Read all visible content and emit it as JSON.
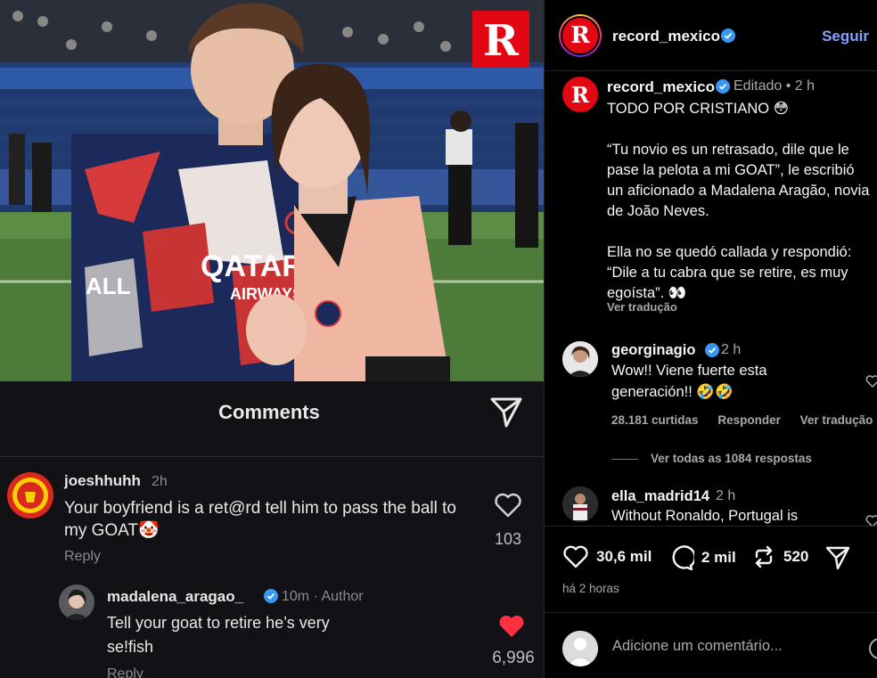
{
  "media": {
    "brand_logo_letter": "R",
    "embedded": {
      "title": "Comments",
      "comment1": {
        "user": "joeshhuhh",
        "time": "2h",
        "text": "Your boyfriend is a ret@rd tell him to pass the ball to my GOAT🤡",
        "reply": "Reply",
        "likes": "103"
      },
      "comment2": {
        "user": "madalena_aragao_",
        "time": "10m · Author",
        "text": "Tell your goat to retire he’s very se!fish",
        "reply": "Reply",
        "likes": "6,996"
      }
    }
  },
  "post": {
    "header": {
      "user": "record_mexico",
      "follow_label": "Seguir",
      "avatar_letter": "R"
    },
    "caption": {
      "user": "record_mexico",
      "edited": "Editado • 2 h",
      "text": "TODO POR CRISTIANO 😳\n\n“Tu novio es un retrasado, dile que le pase la pelota a mi GOAT”, le escribió un aficionado a Madalena Aragão, novia de João Neves.\n\nElla no se quedó callada y respondió: “Dile a tu cabra que se retire, es muy egoísta”. 👀",
      "translate": "Ver tradução"
    },
    "comments": [
      {
        "user": "georginagio",
        "time": "2 h",
        "text": "Wow!! Viene fuerte esta generación!! 🤣🤣",
        "likes": "28.181 curtidas",
        "reply": "Responder",
        "translate": "Ver tradução"
      },
      {
        "user": "ella_madrid14",
        "time": "2 h",
        "text": "Without Ronaldo, Portugal is"
      }
    ],
    "view_replies": "Ver todas as 1084 respostas",
    "actions": {
      "likes": "30,6 mil",
      "comments": "2 mil",
      "reposts": "520"
    },
    "time_ago": "há 2 horas",
    "add_comment_placeholder": "Adicione um comentário..."
  },
  "colors": {
    "follow": "#85a1ff",
    "verified": "#3897f0",
    "brand_red": "#e30613",
    "psg_navy": "#1b2a5a",
    "liked_heart": "#ff3040"
  }
}
